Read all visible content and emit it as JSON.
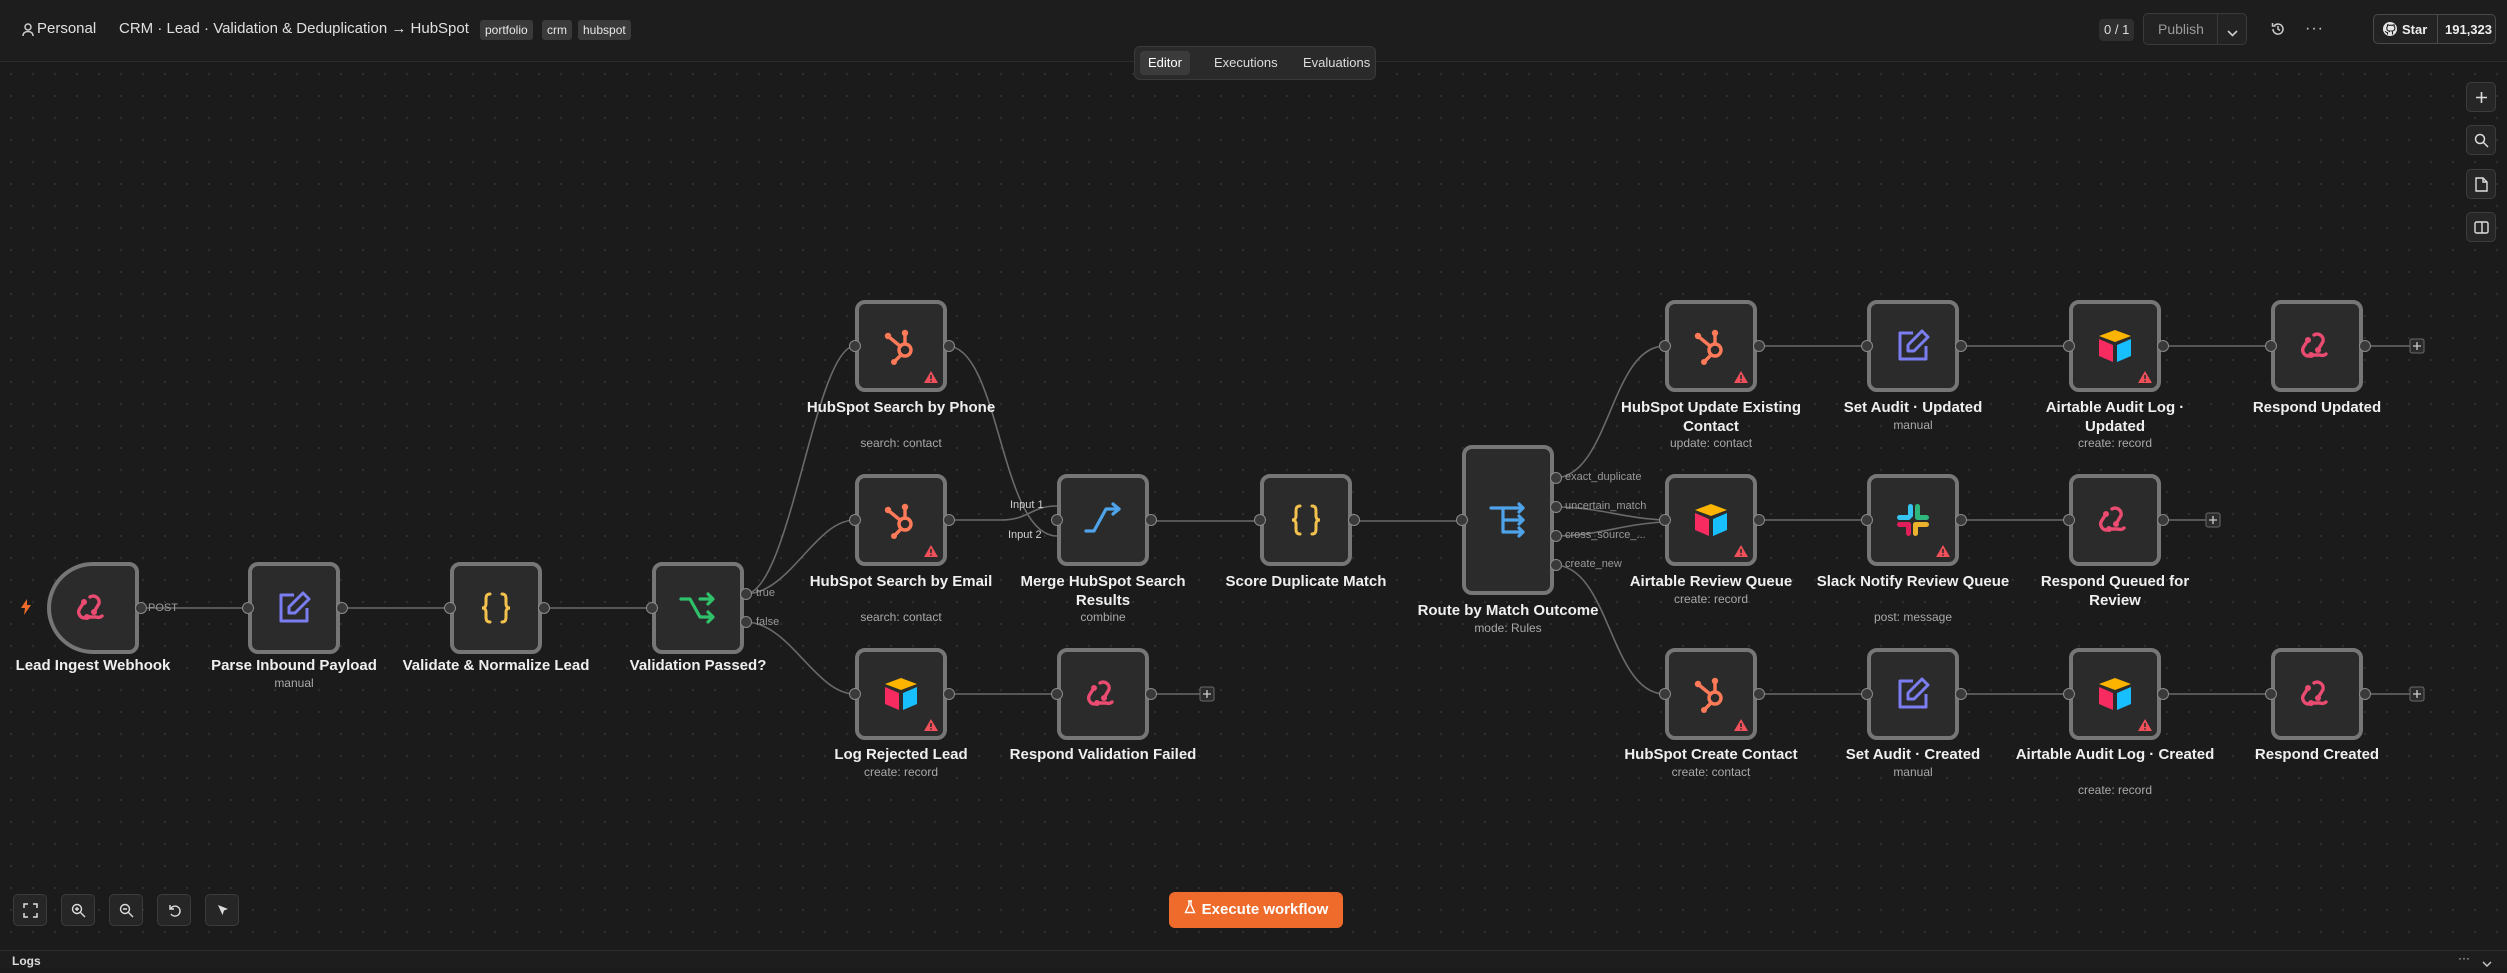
{
  "header": {
    "workspace": "Personal",
    "title": "CRM · Lead · Validation & Deduplication → HubSpot",
    "tags": [
      "portfolio",
      "crm",
      "hubspot"
    ],
    "version_badge": "0 / 1",
    "publish_label": "Publish",
    "star_label": "Star",
    "star_count": "191,323"
  },
  "tabs": [
    "Editor",
    "Executions",
    "Evaluations"
  ],
  "nodes": [
    {
      "label": "Lead Ingest Webhook",
      "sub": "",
      "icon": "webhook-icon"
    },
    {
      "label": "Parse Inbound Payload",
      "sub": "manual",
      "icon": "edit-icon"
    },
    {
      "label": "Validate & Normalize Lead",
      "sub": "",
      "icon": "code-icon"
    },
    {
      "label": "Validation Passed?",
      "sub": "",
      "icon": "if-icon"
    },
    {
      "label": "HubSpot Search by Phone",
      "sub": "search: contact",
      "icon": "hubspot-icon"
    },
    {
      "label": "HubSpot Search by Email",
      "sub": "search: contact",
      "icon": "hubspot-icon"
    },
    {
      "label": "Log Rejected Lead",
      "sub": "create: record",
      "icon": "airtable-icon"
    },
    {
      "label": "Merge HubSpot Search Results",
      "sub": "combine",
      "icon": "merge-icon"
    },
    {
      "label": "Respond Validation Failed",
      "sub": "",
      "icon": "webhook-icon"
    },
    {
      "label": "Score Duplicate Match",
      "sub": "",
      "icon": "code-icon"
    },
    {
      "label": "Route by Match Outcome",
      "sub": "mode: Rules",
      "icon": "switch-icon"
    },
    {
      "label": "HubSpot Update Existing Contact",
      "sub": "update: contact",
      "icon": "hubspot-icon"
    },
    {
      "label": "Airtable Review Queue",
      "sub": "create: record",
      "icon": "airtable-icon"
    },
    {
      "label": "HubSpot Create Contact",
      "sub": "create: contact",
      "icon": "hubspot-icon"
    },
    {
      "label": "Set Audit · Updated",
      "sub": "manual",
      "icon": "edit-icon"
    },
    {
      "label": "Slack Notify Review Queue",
      "sub": "post: message",
      "icon": "slack-icon"
    },
    {
      "label": "Set Audit · Created",
      "sub": "manual",
      "icon": "edit-icon"
    },
    {
      "label": "Airtable Audit Log · Updated",
      "sub": "create: record",
      "icon": "airtable-icon"
    },
    {
      "label": "Respond Queued for Review",
      "sub": "",
      "icon": "webhook-icon"
    },
    {
      "label": "Airtable Audit Log · Created",
      "sub": "create: record",
      "icon": "airtable-icon"
    },
    {
      "label": "Respond Updated",
      "sub": "",
      "icon": "webhook-icon"
    },
    {
      "label": "Respond Created",
      "sub": "",
      "icon": "webhook-icon"
    }
  ],
  "ports": {
    "post": "POST",
    "true": "true",
    "false": "false",
    "input1": "Input 1",
    "input2": "Input 2",
    "exact": "exact_duplicate",
    "uncertain": "uncertain_match",
    "cross": "cross_source_...",
    "create": "create_new"
  },
  "execute_label": "Execute workflow",
  "logs_label": "Logs",
  "colors": {
    "accent": "#ee6b2b",
    "webhook": "#ea4b71",
    "hubspot": "#ff7a59",
    "edit": "#7b7ef0",
    "code": "#f2c14e",
    "if": "#2fc26b",
    "switch": "#4fa3ea"
  }
}
